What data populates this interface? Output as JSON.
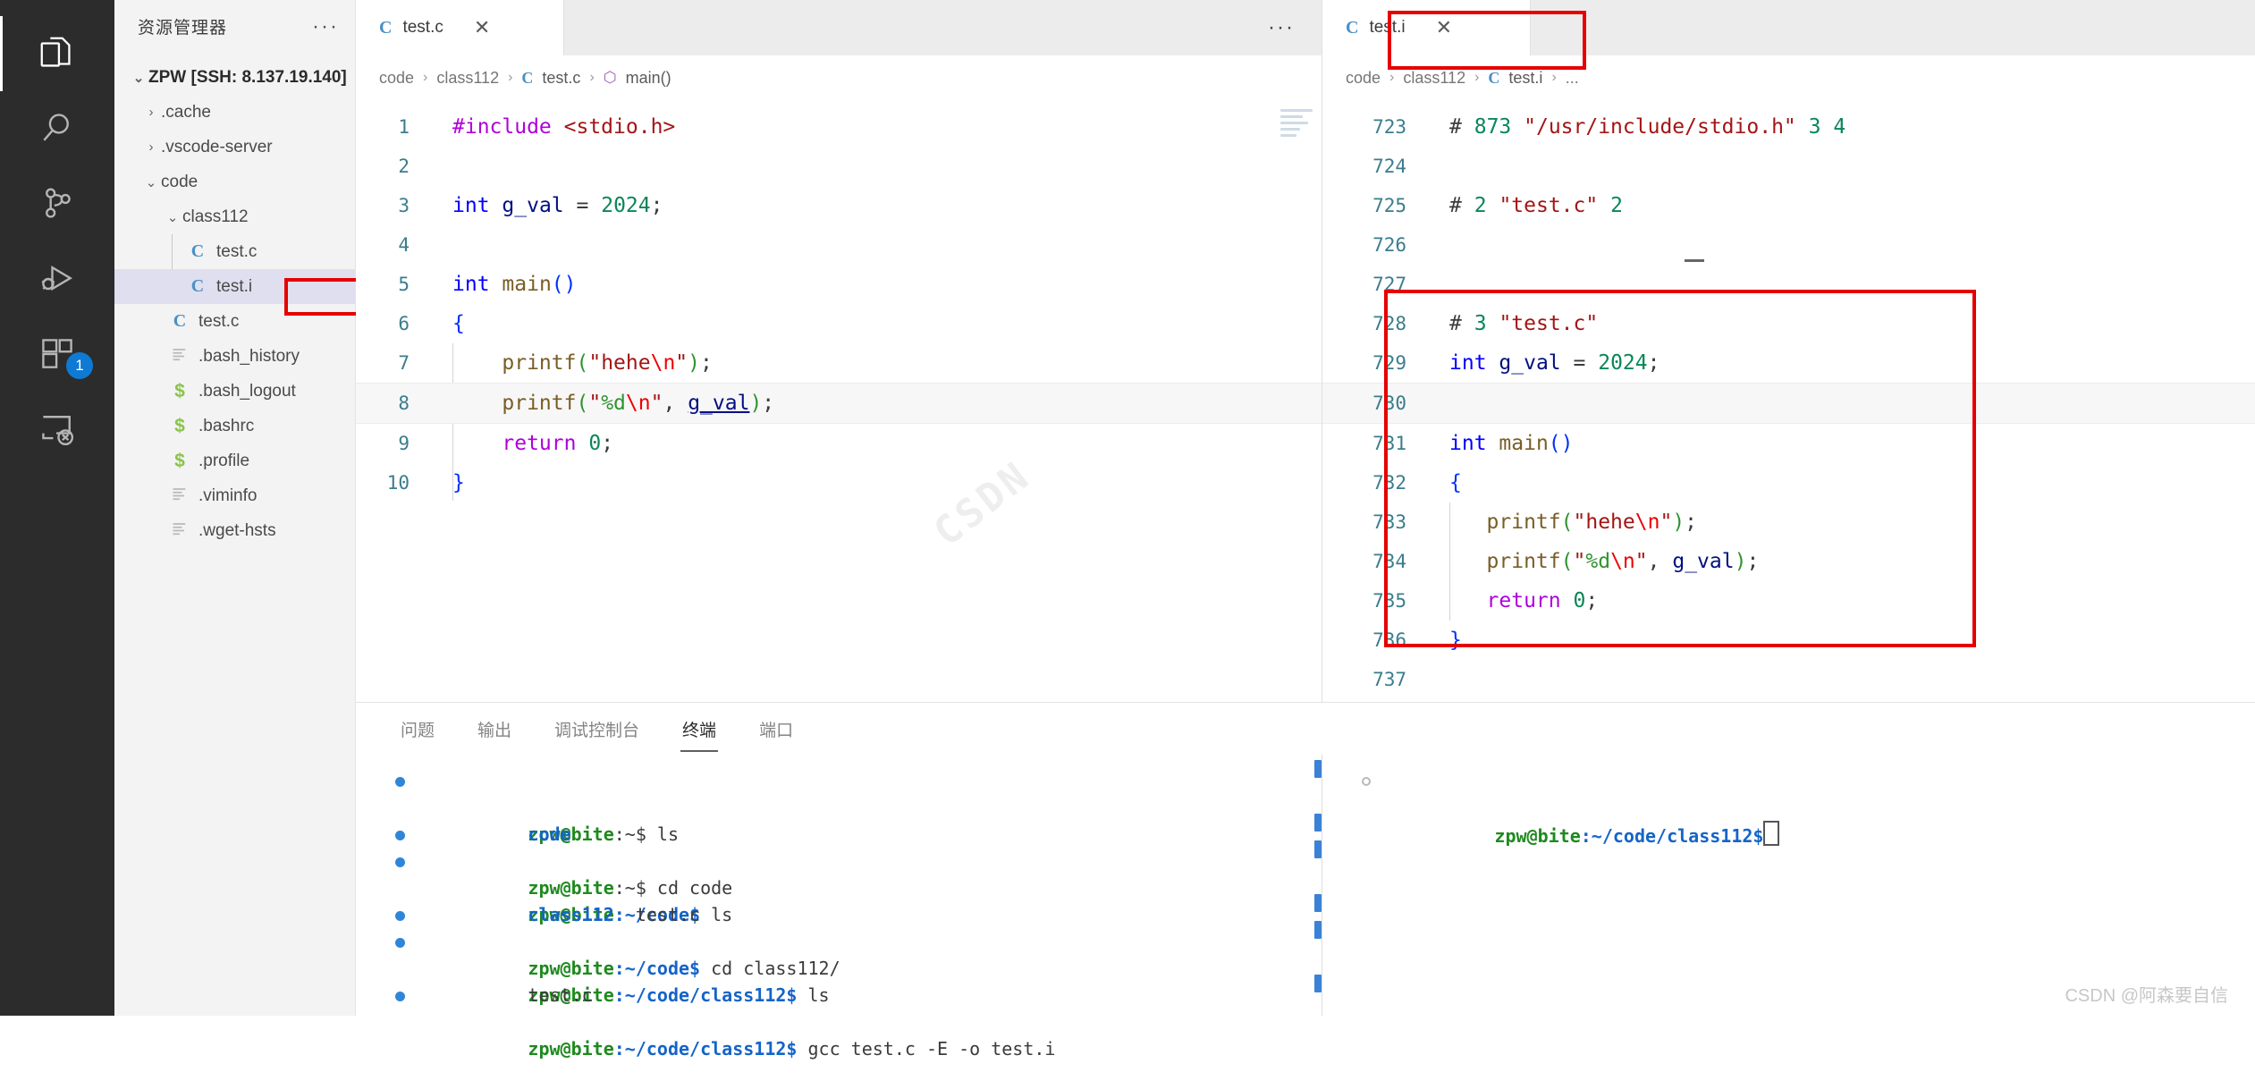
{
  "activity_bar": {
    "items": [
      {
        "name": "explorer",
        "icon": "files-icon",
        "active": true,
        "badge": null
      },
      {
        "name": "search",
        "icon": "search-icon",
        "active": false,
        "badge": null
      },
      {
        "name": "source-control",
        "icon": "source-control-icon",
        "active": false,
        "badge": null
      },
      {
        "name": "run-debug",
        "icon": "run-and-debug-icon",
        "active": false,
        "badge": null
      },
      {
        "name": "extensions",
        "icon": "extensions-icon",
        "active": false,
        "badge": "1"
      },
      {
        "name": "remote-explorer",
        "icon": "remote-explorer-icon",
        "active": false,
        "badge": null
      }
    ]
  },
  "sidebar": {
    "title": "资源管理器",
    "more_actions": "···",
    "root": {
      "label": "ZPW [SSH: 8.137.19.140]",
      "expanded": true,
      "chevron": "⌄"
    },
    "items": [
      {
        "label": ".cache",
        "type": "folder",
        "chevron": "›",
        "indent": 1,
        "icon": null,
        "selected": false
      },
      {
        "label": ".vscode-server",
        "type": "folder",
        "chevron": "›",
        "indent": 1,
        "icon": null,
        "selected": false
      },
      {
        "label": "code",
        "type": "folder",
        "chevron": "⌄",
        "indent": 1,
        "icon": null,
        "selected": false
      },
      {
        "label": "class112",
        "type": "folder",
        "chevron": "⌄",
        "indent": 2,
        "icon": null,
        "selected": false
      },
      {
        "label": "test.c",
        "type": "file",
        "chevron": "",
        "indent": 3,
        "icon": "c-file-icon",
        "selected": false
      },
      {
        "label": "test.i",
        "type": "file",
        "chevron": "",
        "indent": 3,
        "icon": "c-file-icon",
        "selected": true
      },
      {
        "label": "test.c",
        "type": "file",
        "chevron": "",
        "indent": 2,
        "icon": "c-file-icon",
        "selected": false
      },
      {
        "label": ".bash_history",
        "type": "file",
        "chevron": "",
        "indent": 2,
        "icon": "text-file-icon",
        "selected": false
      },
      {
        "label": ".bash_logout",
        "type": "file",
        "chevron": "",
        "indent": 2,
        "icon": "shell-file-icon",
        "selected": false
      },
      {
        "label": ".bashrc",
        "type": "file",
        "chevron": "",
        "indent": 2,
        "icon": "shell-file-icon",
        "selected": false
      },
      {
        "label": ".profile",
        "type": "file",
        "chevron": "",
        "indent": 2,
        "icon": "shell-file-icon",
        "selected": false
      },
      {
        "label": ".viminfo",
        "type": "file",
        "chevron": "",
        "indent": 2,
        "icon": "text-file-icon",
        "selected": false
      },
      {
        "label": ".wget-hsts",
        "type": "file",
        "chevron": "",
        "indent": 2,
        "icon": "text-file-icon",
        "selected": false
      }
    ]
  },
  "editor_left": {
    "tab": {
      "label": "test.c",
      "icon": "c-file-icon",
      "close": "✕"
    },
    "tab_actions": "···",
    "breadcrumb": [
      "code",
      "class112",
      "test.c",
      "main()"
    ],
    "watermark": "CSDN",
    "lines": [
      {
        "num": "1",
        "text": "#include <stdio.h>"
      },
      {
        "num": "2",
        "text": ""
      },
      {
        "num": "3",
        "text": "int g_val = 2024;"
      },
      {
        "num": "4",
        "text": ""
      },
      {
        "num": "5",
        "text": "int main()"
      },
      {
        "num": "6",
        "text": "{"
      },
      {
        "num": "7",
        "text": "    printf(\"hehe\\n\");"
      },
      {
        "num": "8",
        "text": "    printf(\"%d\\n\", g_val);"
      },
      {
        "num": "9",
        "text": "    return 0;"
      },
      {
        "num": "10",
        "text": "}"
      }
    ]
  },
  "editor_right": {
    "tab": {
      "label": "test.i",
      "icon": "c-file-icon",
      "close": "✕"
    },
    "breadcrumb": [
      "code",
      "class112",
      "test.i",
      "..."
    ],
    "lines": [
      {
        "num": "723",
        "text": "# 873 \"/usr/include/stdio.h\" 3 4"
      },
      {
        "num": "724",
        "text": ""
      },
      {
        "num": "725",
        "text": "# 2 \"test.c\" 2"
      },
      {
        "num": "726",
        "text": ""
      },
      {
        "num": "727",
        "text": ""
      },
      {
        "num": "728",
        "text": "# 3 \"test.c\""
      },
      {
        "num": "729",
        "text": "int g_val = 2024;"
      },
      {
        "num": "730",
        "text": ""
      },
      {
        "num": "731",
        "text": "int main()"
      },
      {
        "num": "732",
        "text": "{"
      },
      {
        "num": "733",
        "text": "    printf(\"hehe\\n\");"
      },
      {
        "num": "734",
        "text": "    printf(\"%d\\n\", g_val);"
      },
      {
        "num": "735",
        "text": "    return 0;"
      },
      {
        "num": "736",
        "text": "}"
      },
      {
        "num": "737",
        "text": ""
      }
    ]
  },
  "panel": {
    "tabs": [
      {
        "label": "问题",
        "active": false
      },
      {
        "label": "输出",
        "active": false
      },
      {
        "label": "调试控制台",
        "active": false
      },
      {
        "label": "终端",
        "active": true
      },
      {
        "label": "端口",
        "active": false
      }
    ],
    "terminal_left": [
      {
        "user": "zpw@bite",
        "path": ":~$",
        "cmd": " ls",
        "marker": "dot"
      },
      {
        "output": "code",
        "style": "dir",
        "marker": "none"
      },
      {
        "user": "zpw@bite",
        "path": ":~$",
        "cmd": " cd code",
        "marker": "dot"
      },
      {
        "user": "zpw@bite",
        "path": ":~/code$",
        "cmd": " ls",
        "marker": "dot"
      },
      {
        "output": "class112  test.c",
        "style": "mixed",
        "marker": "none"
      },
      {
        "user": "zpw@bite",
        "path": ":~/code$",
        "cmd": " cd class112/",
        "marker": "dot"
      },
      {
        "user": "zpw@bite",
        "path": ":~/code/class112$",
        "cmd": " ls",
        "marker": "dot"
      },
      {
        "output": "test.c",
        "style": "plain",
        "marker": "none"
      },
      {
        "user": "zpw@bite",
        "path": ":~/code/class112$",
        "cmd": " gcc test.c -E -o test.i",
        "marker": "dot",
        "highlight": "test.i"
      }
    ],
    "terminal_right": [
      {
        "user": "zpw@bite",
        "path": ":~/code/class112$",
        "cmd": " ",
        "marker": "ring",
        "cursor": true
      }
    ]
  },
  "watermark_text": "CSDN @阿森要自信",
  "colors": {
    "accent": "#0e7ad4",
    "highlight_box": "#e60000",
    "selection": "#dfdff0",
    "activitybar_bg": "#2c2c2c",
    "sidebar_bg": "#f3f3f3",
    "editor_bg": "#ffffff"
  }
}
